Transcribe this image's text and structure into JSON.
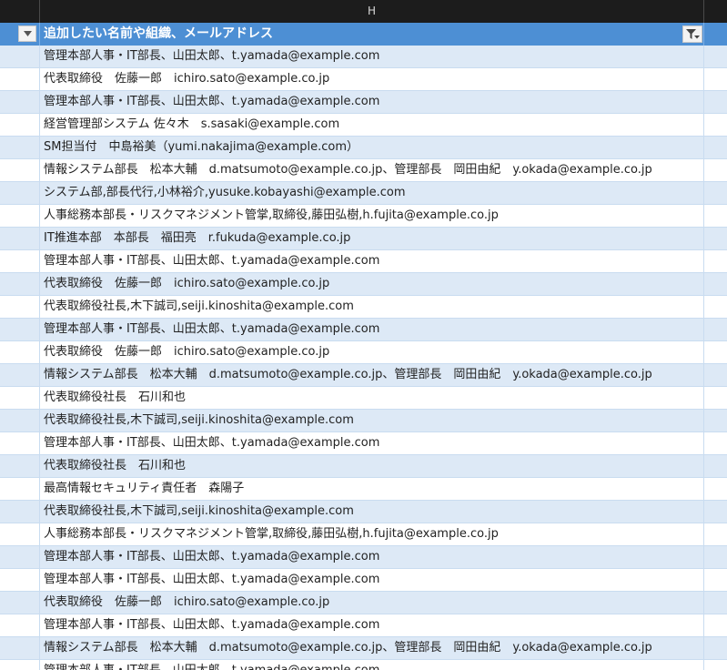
{
  "column_header": {
    "label": "H"
  },
  "table_header": {
    "title": "追加したい名前や組織、メールアドレス"
  },
  "rows": [
    "管理本部人事・IT部長、山田太郎、t.yamada@example.com",
    "代表取締役　佐藤一郎　ichiro.sato@example.co.jp",
    "管理本部人事・IT部長、山田太郎、t.yamada@example.com",
    "経営管理部システム 佐々木　s.sasaki@example.com",
    "SM担当付　中島裕美（yumi.nakajima@example.com）",
    "情報システム部長　松本大輔　d.matsumoto@example.co.jp、管理部長　岡田由紀　y.okada@example.co.jp",
    "システム部,部長代行,小林裕介,yusuke.kobayashi@example.com",
    "人事総務本部長・リスクマネジメント管掌,取締役,藤田弘樹,h.fujita@example.co.jp",
    "IT推進本部　本部長　福田亮　r.fukuda@example.co.jp",
    "管理本部人事・IT部長、山田太郎、t.yamada@example.com",
    "代表取締役　佐藤一郎　ichiro.sato@example.co.jp",
    "代表取締役社長,木下誠司,seiji.kinoshita@example.com",
    "管理本部人事・IT部長、山田太郎、t.yamada@example.com",
    "代表取締役　佐藤一郎　ichiro.sato@example.co.jp",
    "情報システム部長　松本大輔　d.matsumoto@example.co.jp、管理部長　岡田由紀　y.okada@example.co.jp",
    "代表取締役社長　石川和也",
    "代表取締役社長,木下誠司,seiji.kinoshita@example.com",
    "管理本部人事・IT部長、山田太郎、t.yamada@example.com",
    "代表取締役社長　石川和也",
    "最高情報セキュリティ責任者　森陽子",
    "代表取締役社長,木下誠司,seiji.kinoshita@example.com",
    "人事総務本部長・リスクマネジメント管掌,取締役,藤田弘樹,h.fujita@example.co.jp",
    "管理本部人事・IT部長、山田太郎、t.yamada@example.com",
    "管理本部人事・IT部長、山田太郎、t.yamada@example.com",
    "代表取締役　佐藤一郎　ichiro.sato@example.co.jp",
    "管理本部人事・IT部長、山田太郎、t.yamada@example.com",
    "情報システム部長　松本大輔　d.matsumoto@example.co.jp、管理部長　岡田由紀　y.okada@example.co.jp",
    "管理本部人事・IT部長、山田太郎、t.yamada@example.com"
  ],
  "icons": {
    "left_dropdown": "chevron-down-icon",
    "filter": "filter-icon"
  },
  "colors": {
    "header_bg": "#4d8fd4",
    "band_bg": "#dde9f6",
    "col_header_bg": "#1c1c1c"
  }
}
